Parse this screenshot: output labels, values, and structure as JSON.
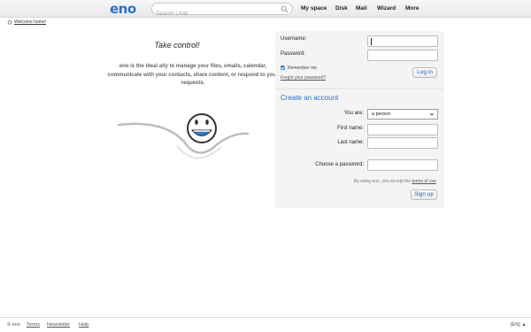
{
  "header": {
    "logo": "eno",
    "search_placeholder": "Search | Ask",
    "nav": [
      "My space",
      "Disk",
      "Mail",
      "Wizard",
      "More"
    ]
  },
  "breadcrumb": "Welcome home!",
  "promo": {
    "headline": "Take control!",
    "text": "eno is the ideal ally to manage your files, emails, calendar, communicate with your contacts, share content, or respond to your requests."
  },
  "login": {
    "username_label": "Username:",
    "password_label": "Password:",
    "remember_label": "Remember me",
    "forgot_link": "Forgot your password?",
    "login_button": "Log in"
  },
  "signup": {
    "title": "Create an account",
    "you_are_label": "You are:",
    "you_are_value": "a person",
    "first_name_label": "First name:",
    "last_name_label": "Last name:",
    "choose_password_label": "Choose a password:",
    "terms_prefix": "By using eno, you accept the",
    "terms_link": "terms of use",
    "signup_button": "Sign up"
  },
  "footer": {
    "copyright": "© eno",
    "links": [
      "Terms",
      "Newsletter",
      "Help"
    ],
    "language": "[EN] ▲"
  },
  "colors": {
    "brand": "#2a73c7",
    "link": "#1b5fae"
  }
}
